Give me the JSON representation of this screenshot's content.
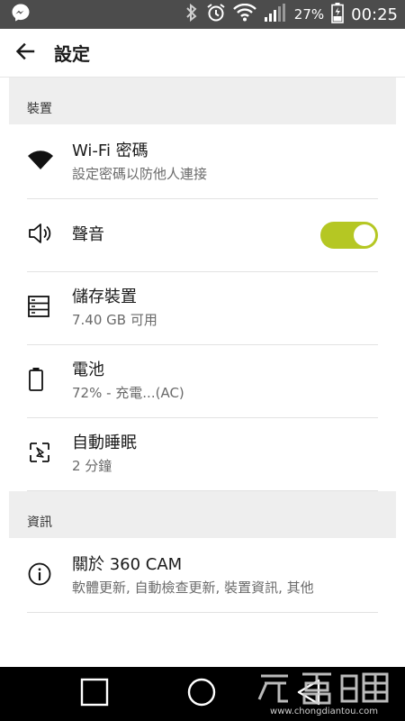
{
  "status_bar": {
    "battery_pct": "27%",
    "time": "00:25",
    "icons": [
      "messenger-icon",
      "bluetooth-icon",
      "alarm-icon",
      "wifi-icon",
      "signal-icon",
      "battery-icon"
    ]
  },
  "app_bar": {
    "title": "設定",
    "back_icon": "arrow-left-icon"
  },
  "sections": [
    {
      "header": "裝置",
      "items": [
        {
          "title": "Wi-Fi 密碼",
          "subtitle": "設定密碼以防他人連接",
          "icon": "wifi-icon"
        },
        {
          "title": "聲音",
          "subtitle": "",
          "icon": "speaker-icon",
          "toggle_on": true
        },
        {
          "title": "儲存裝置",
          "subtitle": "7.40 GB 可用",
          "icon": "storage-icon"
        },
        {
          "title": "電池",
          "subtitle": "72% - 充電...(AC)",
          "icon": "battery-icon"
        },
        {
          "title": "自動睡眠",
          "subtitle": "2 分鐘",
          "icon": "sleep-icon"
        }
      ]
    },
    {
      "header": "資訊",
      "items": [
        {
          "title": "關於 360 CAM",
          "subtitle": "軟體更新, 自動檢查更新, 裝置資訊, 其他",
          "icon": "info-icon"
        }
      ]
    }
  ],
  "nav_bar": {
    "icons": [
      "recents-square-icon",
      "home-circle-icon",
      "back-triangle-icon"
    ]
  },
  "colors": {
    "status_bar": "#4c4c4c",
    "toggle_on": "#b5c723",
    "section_bg": "#eeeeee",
    "nav_bar": "#000000"
  },
  "watermark": {
    "url_text": "www.chongdiantou.com"
  }
}
